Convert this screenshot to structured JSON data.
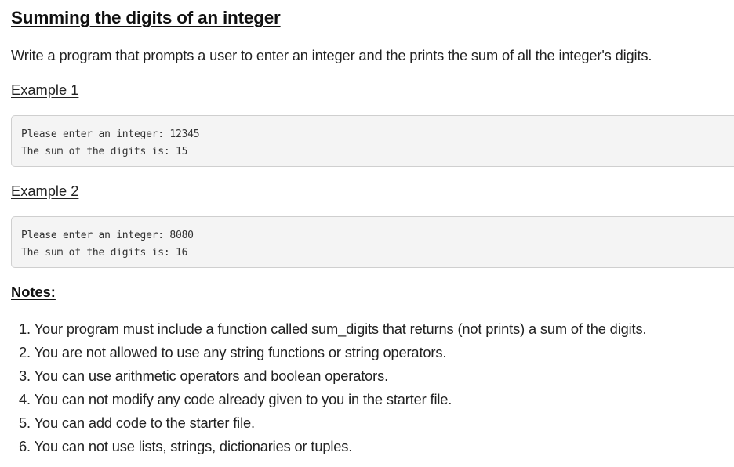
{
  "title": "Summing the digits of an integer",
  "intro": "Write a program that prompts a user to enter an integer and the prints the sum of all the integer's digits.",
  "examples": [
    {
      "heading": "Example 1",
      "lines": [
        "Please enter an integer: 12345",
        "The sum of the digits is: 15"
      ]
    },
    {
      "heading": "Example 2",
      "lines": [
        "Please enter an integer: 8080",
        "The sum of the digits is: 16"
      ]
    }
  ],
  "notes": {
    "heading": "Notes:",
    "items": [
      {
        "num": "1.",
        "text": "Your program must include a function called sum_digits that returns (not prints) a sum of the digits."
      },
      {
        "num": "2.",
        "text": "You are not allowed to use any string functions or string operators."
      },
      {
        "num": "3.",
        "text": "You can use arithmetic operators and boolean operators."
      },
      {
        "num": "4.",
        "text": "You can not modify any code already given to you in the starter file."
      },
      {
        "num": "5.",
        "text": "You can add code to the starter file."
      },
      {
        "num": "6.",
        "text": "You can not use lists, strings, dictionaries or tuples."
      }
    ]
  }
}
